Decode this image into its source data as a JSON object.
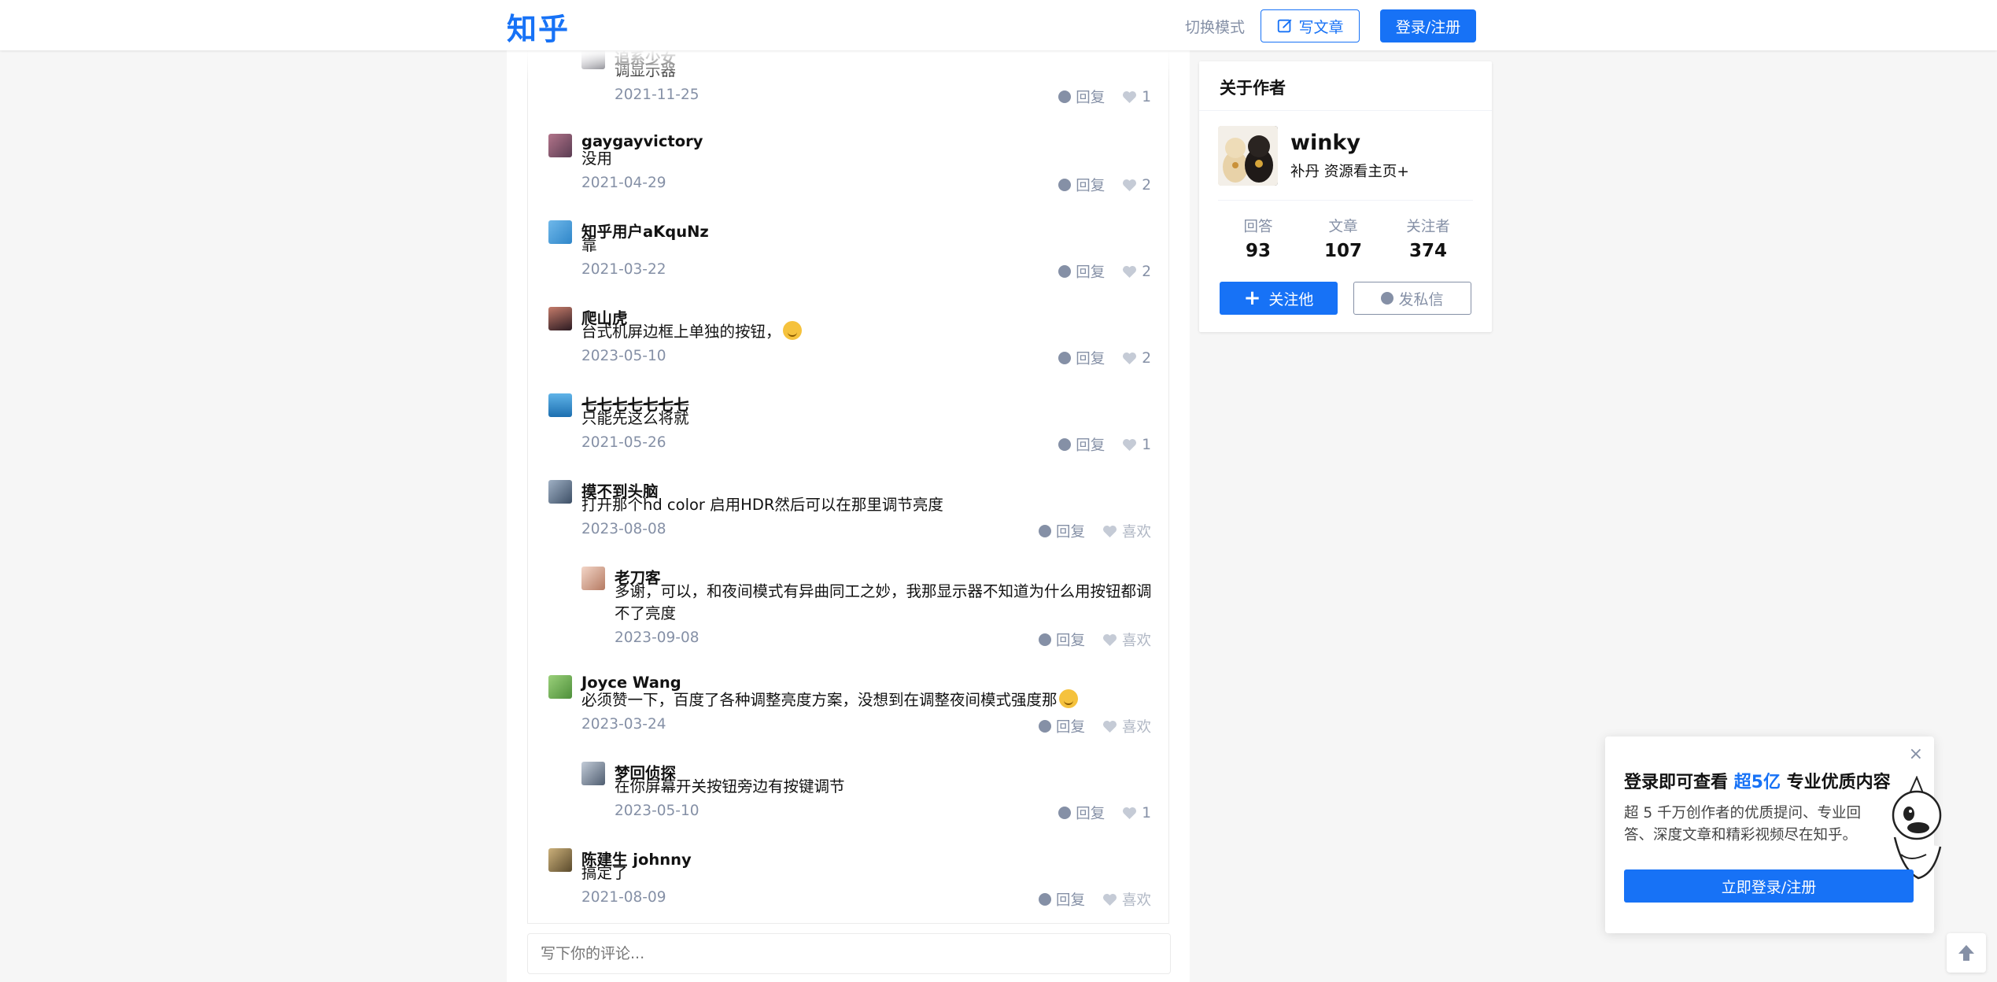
{
  "header": {
    "logo": "知乎",
    "switch_mode": "切换模式",
    "write_article": "写文章",
    "login_register": "登录/注册"
  },
  "comments": [
    {
      "name": "追系少女",
      "text": "调显示器",
      "date": "2021-11-25",
      "reply": "回复",
      "likes": "1",
      "nested": true
    },
    {
      "name": "gaygayvictory",
      "text": "没用",
      "date": "2021-04-29",
      "reply": "回复",
      "likes": "2",
      "nested": false
    },
    {
      "name": "知乎用户aKquNz",
      "text": "靠",
      "date": "2021-03-22",
      "reply": "回复",
      "likes": "2",
      "nested": false
    },
    {
      "name": "爬山虎",
      "text": "台式机屏边框上单独的按钮，",
      "date": "2023-05-10",
      "reply": "回复",
      "likes": "2",
      "nested": false
    },
    {
      "name": "七七七七七七七",
      "text": "只能先这么将就",
      "date": "2021-05-26",
      "reply": "回复",
      "likes": "1",
      "nested": false
    },
    {
      "name": "摸不到头脑",
      "text": "打开那个hd color 启用HDR然后可以在那里调节亮度",
      "date": "2023-08-08",
      "reply": "回复",
      "likes": "喜欢",
      "nested": false
    },
    {
      "name": "老刀客",
      "text": "多谢，可以，和夜间模式有异曲同工之妙，我那显示器不知道为什么用按钮都调不了亮度",
      "date": "2023-09-08",
      "reply": "回复",
      "likes": "喜欢",
      "nested": true
    },
    {
      "name": "Joyce Wang",
      "text": "必须赞一下，百度了各种调整亮度方案，没想到在调整夜间模式强度那",
      "date": "2023-03-24",
      "reply": "回复",
      "likes": "喜欢",
      "nested": false
    },
    {
      "name": "梦回侦探",
      "text": "在你屏幕开关按钮旁边有按键调节",
      "date": "2023-05-10",
      "reply": "回复",
      "likes": "1",
      "nested": true
    },
    {
      "name": "陈建生 johnny",
      "text": "搞定了",
      "date": "2021-08-09",
      "reply": "回复",
      "likes": "喜欢",
      "nested": false
    }
  ],
  "comment_input": {
    "placeholder": "写下你的评论..."
  },
  "author_card": {
    "title": "关于作者",
    "name": "winky",
    "bio": "补丹 资源看主页+",
    "stats": [
      {
        "label": "回答",
        "value": "93"
      },
      {
        "label": "文章",
        "value": "107"
      },
      {
        "label": "关注者",
        "value": "374"
      }
    ],
    "follow": "关注他",
    "message": "发私信"
  },
  "login_popup": {
    "title_prefix": "登录即可查看 ",
    "title_highlight": "超5亿",
    "title_suffix": " 专业优质内容",
    "desc": "超 5 千万创作者的优质提问、专业回答、深度文章和精彩视频尽在知乎。",
    "button": "立即登录/注册",
    "close": "×"
  },
  "colors": {
    "accent": "#1772f6",
    "muted": "#8590a6"
  },
  "icons": {
    "write": "edit-icon",
    "plus": "plus-icon",
    "message": "chat-bubble-icon",
    "back_to_top": "arrow-up-icon"
  }
}
